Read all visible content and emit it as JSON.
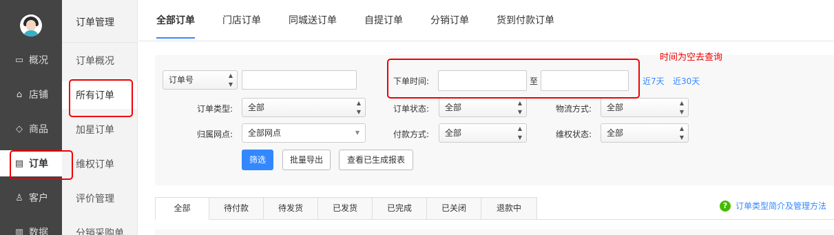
{
  "sidebar": {
    "items": [
      {
        "label": "概况",
        "icon": "monitor-icon"
      },
      {
        "label": "店铺",
        "icon": "shop-icon"
      },
      {
        "label": "商品",
        "icon": "tag-icon"
      },
      {
        "label": "订单",
        "icon": "list-icon"
      },
      {
        "label": "客户",
        "icon": "user-icon"
      },
      {
        "label": "数据",
        "icon": "chart-icon"
      }
    ],
    "active": "订单"
  },
  "subnav": {
    "title": "订单管理",
    "items": [
      "订单概况",
      "所有订单",
      "加星订单",
      "维权订单",
      "评价管理",
      "分销采购单"
    ],
    "active": "所有订单"
  },
  "top_tabs": [
    "全部订单",
    "门店订单",
    "同城送订单",
    "自提订单",
    "分销订单",
    "货到付款订单"
  ],
  "filters": {
    "order_no_select": "订单号",
    "order_time_label": "下单时间:",
    "to_label": "至",
    "last7": "近7天",
    "last30": "近30天",
    "order_type_label": "订单类型:",
    "order_type_value": "全部",
    "order_status_label": "订单状态:",
    "order_status_value": "全部",
    "logistics_label": "物流方式:",
    "logistics_value": "全部",
    "outlet_label": "归属网点:",
    "outlet_value": "全部网点",
    "payment_label": "付款方式:",
    "payment_value": "全部",
    "rights_label": "维权状态:",
    "rights_value": "全部"
  },
  "buttons": {
    "filter": "筛选",
    "export": "批量导出",
    "reports": "查看已生成报表"
  },
  "annotation": "时间为空去查询",
  "status_tabs": [
    "全部",
    "待付款",
    "待发货",
    "已发货",
    "已完成",
    "已关闭",
    "退款中"
  ],
  "help_link": "订单类型简介及管理方法",
  "colors": {
    "accent": "#3388ff",
    "highlight": "#ee0000",
    "sidebar": "#444444"
  }
}
